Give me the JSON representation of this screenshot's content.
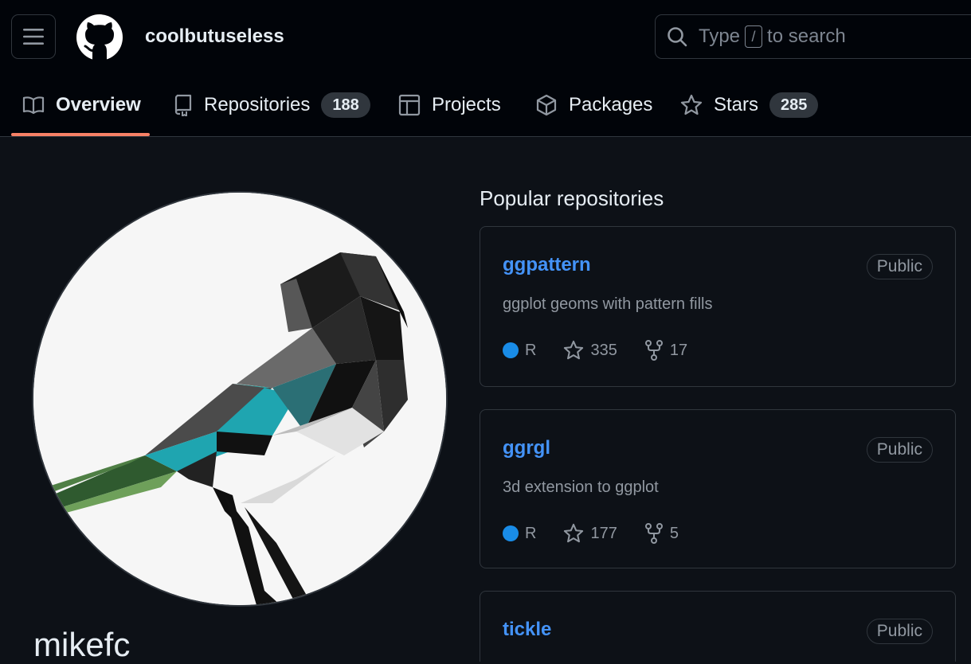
{
  "header": {
    "username": "coolbutuseless",
    "search_prefix": "Type",
    "search_key": "/",
    "search_suffix": "to search"
  },
  "tabs": [
    {
      "label": "Overview",
      "active": true
    },
    {
      "label": "Repositories",
      "count": "188"
    },
    {
      "label": "Projects"
    },
    {
      "label": "Packages"
    },
    {
      "label": "Stars",
      "count": "285"
    }
  ],
  "profile": {
    "display_name": "mikefc"
  },
  "popular": {
    "title": "Popular repositories",
    "repos": [
      {
        "name": "ggpattern",
        "visibility": "Public",
        "description": "ggplot geoms with pattern fills",
        "language": "R",
        "stars": "335",
        "forks": "17"
      },
      {
        "name": "ggrgl",
        "visibility": "Public",
        "description": "3d extension to ggplot",
        "language": "R",
        "stars": "177",
        "forks": "5"
      },
      {
        "name": "tickle",
        "visibility": "Public"
      }
    ]
  },
  "colors": {
    "accent_underline": "#f78166",
    "link": "#4493f8",
    "r_language": "#198ce7"
  }
}
